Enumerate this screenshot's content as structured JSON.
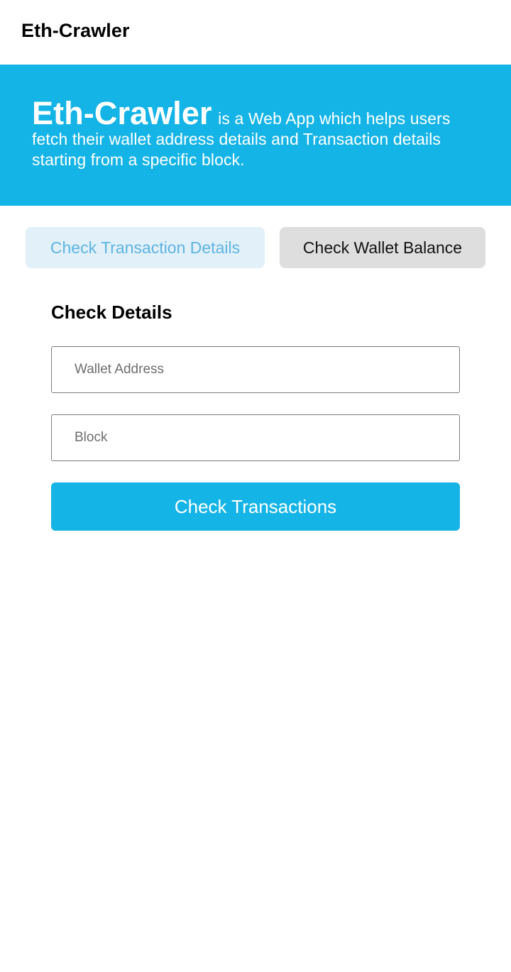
{
  "header": {
    "brand": "Eth-Crawler"
  },
  "hero": {
    "title": "Eth-Crawler",
    "description": "is a Web App which helps users fetch their wallet address details and Transaction details starting from a specific block."
  },
  "tabs": {
    "transactions_label": "Check Transaction Details",
    "wallet_label": "Check Wallet Balance",
    "active": "transactions"
  },
  "form": {
    "title": "Check Details",
    "wallet_placeholder": "Wallet Address",
    "wallet_value": "",
    "block_placeholder": "Block",
    "block_value": "",
    "submit_label": "Check Transactions"
  },
  "colors": {
    "accent": "#15b4e6",
    "active_tab_bg": "#e1f0f9",
    "active_tab_text": "#5fb4e2",
    "inactive_tab_bg": "#dedede"
  }
}
